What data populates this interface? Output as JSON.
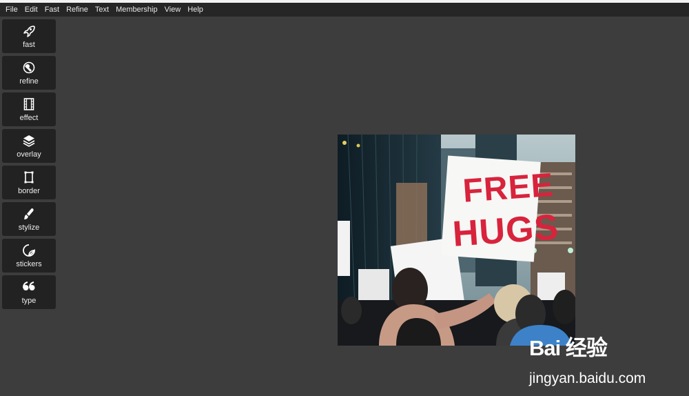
{
  "menu": {
    "items": [
      {
        "label": "File"
      },
      {
        "label": "Edit"
      },
      {
        "label": "Fast"
      },
      {
        "label": "Refine"
      },
      {
        "label": "Text"
      },
      {
        "label": "Membership"
      },
      {
        "label": "View"
      },
      {
        "label": "Help"
      }
    ]
  },
  "toolbar": {
    "tools": [
      {
        "label": "fast",
        "icon": "rocket-icon"
      },
      {
        "label": "refine",
        "icon": "refine-icon"
      },
      {
        "label": "effect",
        "icon": "film-icon"
      },
      {
        "label": "overlay",
        "icon": "layers-icon"
      },
      {
        "label": "border",
        "icon": "frame-icon"
      },
      {
        "label": "stylize",
        "icon": "brush-icon"
      },
      {
        "label": "stickers",
        "icon": "sticker-icon"
      },
      {
        "label": "type",
        "icon": "quote-icon"
      }
    ]
  },
  "canvas": {
    "photo": {
      "sign_line1": "FREE",
      "sign_line2": "HUGS"
    }
  },
  "watermark": {
    "logo": "Bai 经验",
    "url": "jingyan.baidu.com"
  },
  "colors": {
    "menubar_bg": "#262626",
    "workspace_bg": "#3d3d3d",
    "tool_bg": "#222222",
    "sign_text": "#d8233c"
  }
}
